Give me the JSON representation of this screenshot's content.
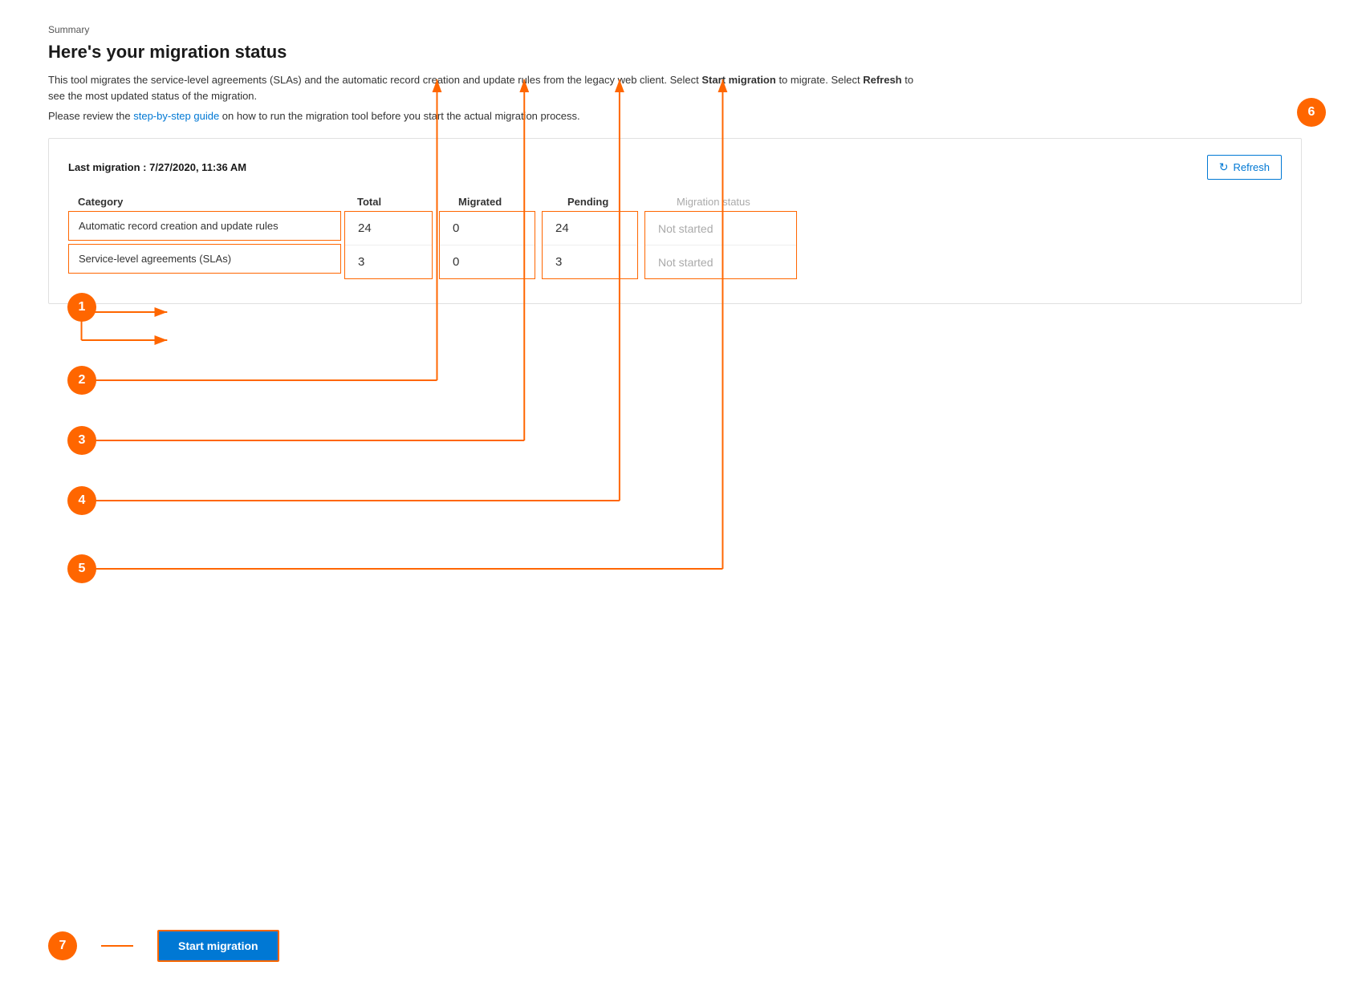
{
  "breadcrumb": "Summary",
  "title": "Here's your migration status",
  "description": "This tool migrates the service-level agreements (SLAs) and the automatic record creation and update rules from the legacy web client. Select ",
  "description_bold1": "Start migration",
  "description_mid": " to migrate. Select ",
  "description_bold2": "Refresh",
  "description_end": " to see the most updated status of the migration.",
  "guide_prefix": "Please review the ",
  "guide_link": "step-by-step guide",
  "guide_suffix": " on how to run the migration tool before you start the actual migration process.",
  "last_migration_label": "Last migration : 7/27/2020, 11:36 AM",
  "refresh_button": "Refresh",
  "table": {
    "col_category": "Category",
    "col_total": "Total",
    "col_migrated": "Migrated",
    "col_pending": "Pending",
    "col_status": "Migration status",
    "rows": [
      {
        "category": "Automatic record creation and update rules",
        "total": "24",
        "migrated": "0",
        "pending": "24",
        "status": "Not started"
      },
      {
        "category": "Service-level agreements (SLAs)",
        "total": "3",
        "migrated": "0",
        "pending": "3",
        "status": "Not started"
      }
    ]
  },
  "start_migration_label": "Start migration",
  "annotations": [
    "1",
    "2",
    "3",
    "4",
    "5",
    "6",
    "7"
  ]
}
